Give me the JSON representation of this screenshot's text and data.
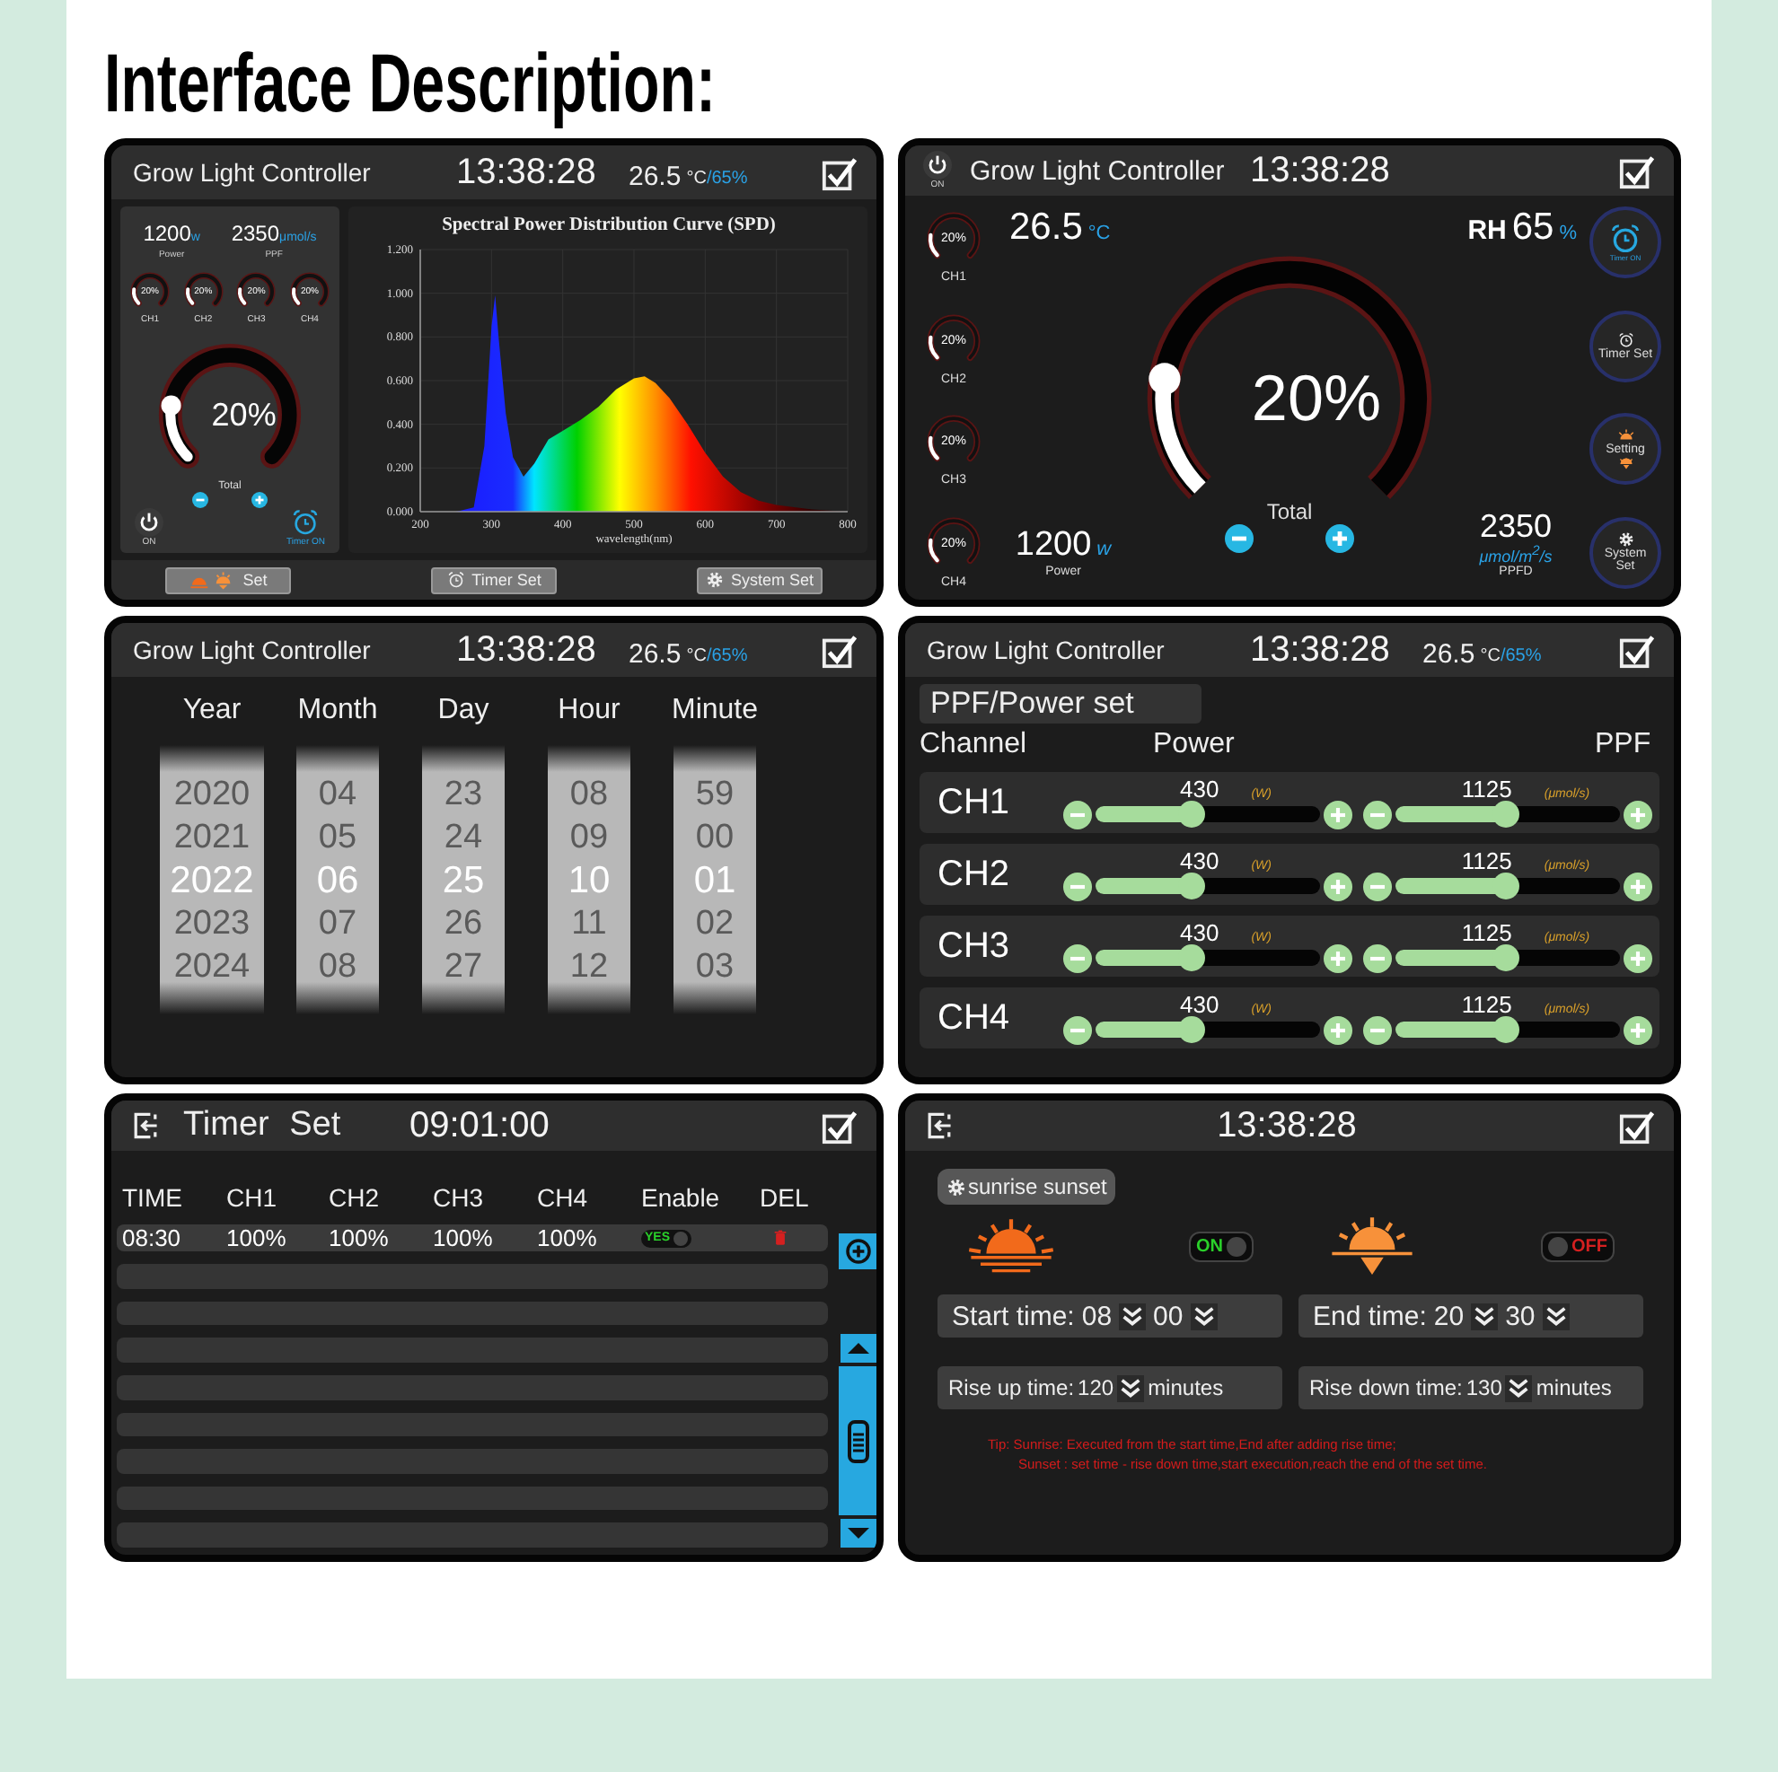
{
  "page": {
    "title": "Interface Description:"
  },
  "overview": {
    "header": {
      "title": "Grow Light Controller",
      "time": "13:38:28",
      "temperature": "26.5",
      "temp_unit": "°C",
      "humidity": "/65%"
    },
    "power": {
      "value": "1200",
      "unit": "w",
      "label": "Power"
    },
    "ppf": {
      "value": "2350",
      "unit": "μmol/s",
      "label": "PPF"
    },
    "channels": [
      {
        "name": "CH1",
        "reading": "20%"
      },
      {
        "name": "CH2",
        "reading": "20%"
      },
      {
        "name": "CH3",
        "reading": "20%"
      },
      {
        "name": "CH4",
        "reading": "20%"
      }
    ],
    "total": {
      "reading": "20%",
      "label": "Total"
    },
    "power_button": {
      "label": "ON"
    },
    "timer_button": {
      "label": "Timer ON"
    },
    "chart_data": {
      "type": "area",
      "title": "Spectral Power Distribution Curve (SPD)",
      "xlabel": "wavelength(nm)",
      "x": [
        250,
        275,
        290,
        300,
        305,
        310,
        320,
        330,
        345,
        360,
        380,
        400,
        425,
        450,
        475,
        500,
        515,
        530,
        550,
        575,
        600,
        625,
        650,
        675,
        700,
        750,
        800
      ],
      "values": [
        0,
        0.02,
        0.3,
        0.85,
        0.99,
        0.8,
        0.45,
        0.25,
        0.16,
        0.22,
        0.33,
        0.37,
        0.42,
        0.48,
        0.56,
        0.61,
        0.62,
        0.59,
        0.52,
        0.4,
        0.27,
        0.16,
        0.09,
        0.05,
        0.03,
        0.01,
        0
      ],
      "xlim": [
        200,
        800
      ],
      "ylim": [
        0,
        1.2
      ],
      "grid": true,
      "xticks": [
        200,
        300,
        400,
        500,
        600,
        700,
        800
      ],
      "yticks": [
        {
          "value": 0,
          "label": "0.000"
        },
        {
          "value": 0.2,
          "label": "0.200"
        },
        {
          "value": 0.4,
          "label": "0.400"
        },
        {
          "value": 0.6,
          "label": "0.600"
        },
        {
          "value": 0.8,
          "label": "0.800"
        },
        {
          "value": 1,
          "label": "1.000"
        },
        {
          "value": 1.2,
          "label": "1.200"
        }
      ]
    },
    "nav": [
      {
        "label": "Set"
      },
      {
        "label": "Timer Set"
      },
      {
        "label": "System Set"
      }
    ]
  },
  "dashboard": {
    "header": {
      "power_label": "ON",
      "title": "Grow Light Controller",
      "time": "13:38:28"
    },
    "channels": [
      {
        "name": "CH1",
        "reading": "20%"
      },
      {
        "name": "CH2",
        "reading": "20%"
      },
      {
        "name": "CH3",
        "reading": "20%"
      },
      {
        "name": "CH4",
        "reading": "20%"
      }
    ],
    "temperature": {
      "value": "26.5",
      "unit": "°C"
    },
    "humidity": {
      "label": "RH",
      "value": "65",
      "unit": "%"
    },
    "total": {
      "reading": "20%",
      "label": "Total"
    },
    "power": {
      "value": "1200",
      "unit": "w",
      "label": "Power"
    },
    "ppfd": {
      "value": "2350",
      "unit": "μmol/m$^{2}$/s",
      "label": "PPFD"
    },
    "side_buttons": [
      {
        "label": "Timer ON"
      },
      {
        "label": "Timer Set"
      },
      {
        "label": "Setting"
      },
      {
        "label": "System Set"
      }
    ]
  },
  "clock": {
    "header": {
      "title": "Grow Light Controller",
      "time": "13:38:28",
      "temperature": "26.5",
      "temp_unit": "°C",
      "humidity": "/65%"
    },
    "columns": [
      {
        "label": "Year",
        "values": [
          {
            "text": "2020",
            "selected": false
          },
          {
            "text": "2021",
            "selected": false
          },
          {
            "text": "2022",
            "selected": true
          },
          {
            "text": "2023",
            "selected": false
          },
          {
            "text": "2024",
            "selected": false
          }
        ]
      },
      {
        "label": "Month",
        "values": [
          {
            "text": "04",
            "selected": false
          },
          {
            "text": "05",
            "selected": false
          },
          {
            "text": "06",
            "selected": true
          },
          {
            "text": "07",
            "selected": false
          },
          {
            "text": "08",
            "selected": false
          }
        ]
      },
      {
        "label": "Day",
        "values": [
          {
            "text": "23",
            "selected": false
          },
          {
            "text": "24",
            "selected": false
          },
          {
            "text": "25",
            "selected": true
          },
          {
            "text": "26",
            "selected": false
          },
          {
            "text": "27",
            "selected": false
          }
        ]
      },
      {
        "label": "Hour",
        "values": [
          {
            "text": "08",
            "selected": false
          },
          {
            "text": "09",
            "selected": false
          },
          {
            "text": "10",
            "selected": true
          },
          {
            "text": "11",
            "selected": false
          },
          {
            "text": "12",
            "selected": false
          }
        ]
      },
      {
        "label": "Minute",
        "values": [
          {
            "text": "59",
            "selected": false
          },
          {
            "text": "00",
            "selected": false
          },
          {
            "text": "01",
            "selected": true
          },
          {
            "text": "02",
            "selected": false
          },
          {
            "text": "03",
            "selected": false
          }
        ]
      }
    ]
  },
  "ppf_set": {
    "header": {
      "title": "Grow Light Controller",
      "time": "13:38:28",
      "temperature": "26.5",
      "temp_unit": "°C",
      "humidity": "/65%"
    },
    "title": "PPF/Power set",
    "columns": [
      "Channel",
      "Power",
      "PPF"
    ],
    "rows": [
      {
        "channel": "CH1",
        "power": {
          "value": "430",
          "unit": "(W)",
          "level": 0.42
        },
        "ppf": {
          "value": "1125",
          "unit": "(μmol/s)",
          "level": 0.49
        }
      },
      {
        "channel": "CH2",
        "power": {
          "value": "430",
          "unit": "(W)",
          "level": 0.42
        },
        "ppf": {
          "value": "1125",
          "unit": "(μmol/s)",
          "level": 0.49
        }
      },
      {
        "channel": "CH3",
        "power": {
          "value": "430",
          "unit": "(W)",
          "level": 0.42
        },
        "ppf": {
          "value": "1125",
          "unit": "(μmol/s)",
          "level": 0.49
        }
      },
      {
        "channel": "CH4",
        "power": {
          "value": "430",
          "unit": "(W)",
          "level": 0.42
        },
        "ppf": {
          "value": "1125",
          "unit": "(μmol/s)",
          "level": 0.49
        }
      }
    ]
  },
  "timer": {
    "header": {
      "title": "Timer Set",
      "time": "09:01:00"
    },
    "columns": [
      "TIME",
      "CH1",
      "CH2",
      "CH3",
      "CH4",
      "Enable",
      "DEL"
    ],
    "rows": [
      {
        "kind": "entry",
        "cells": [
          "08:30",
          "100%",
          "100%",
          "100%",
          "100%"
        ],
        "enable": {
          "label": "YES",
          "on": true
        }
      },
      {
        "kind": "empty"
      },
      {
        "kind": "empty"
      },
      {
        "kind": "empty"
      },
      {
        "kind": "empty"
      },
      {
        "kind": "empty"
      },
      {
        "kind": "empty"
      },
      {
        "kind": "empty"
      },
      {
        "kind": "empty"
      }
    ]
  },
  "sunrise": {
    "header": {
      "time": "13:38:28"
    },
    "chip": "sunrise sunset",
    "sunrise_toggle": {
      "label": "ON",
      "on": true
    },
    "sunset_toggle": {
      "label": "OFF",
      "on": false
    },
    "start": {
      "label": "Start time:",
      "hour": "08",
      "minute": "00"
    },
    "end": {
      "label": "End time:",
      "hour": "20",
      "minute": "30"
    },
    "rise_up": {
      "label": "Rise up time:",
      "value": "120",
      "unit": "minutes"
    },
    "rise_down": {
      "label": "Rise down time:",
      "value": "130",
      "unit": "minutes"
    },
    "tip": [
      "Tip: Sunrise: Executed from the start time,End after adding rise time;",
      "Sunset : set time - rise down time,start execution,reach the end of the set time."
    ]
  }
}
